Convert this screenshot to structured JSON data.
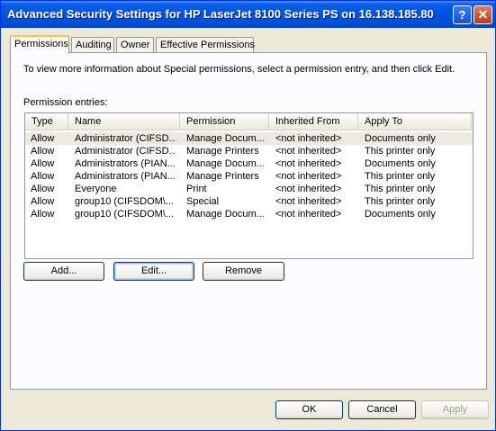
{
  "window": {
    "title": "Advanced Security Settings for HP LaserJet 8100 Series PS on 16.138.185.80",
    "help_glyph": "?",
    "close_glyph": "✕"
  },
  "tabs": [
    {
      "label": "Permissions",
      "active": true
    },
    {
      "label": "Auditing",
      "active": false
    },
    {
      "label": "Owner",
      "active": false
    },
    {
      "label": "Effective Permissions",
      "active": false
    }
  ],
  "permissions_tab": {
    "info_text": "To view more information about Special permissions, select a permission entry, and then click Edit.",
    "entries_label": "Permission entries:",
    "columns": [
      "Type",
      "Name",
      "Permission",
      "Inherited From",
      "Apply To"
    ],
    "rows": [
      {
        "type": "Allow",
        "name": "Administrator (CIFSD...",
        "permission": "Manage Docum...",
        "inherited_from": "<not inherited>",
        "apply_to": "Documents only",
        "selected": true
      },
      {
        "type": "Allow",
        "name": "Administrator (CIFSD...",
        "permission": "Manage Printers",
        "inherited_from": "<not inherited>",
        "apply_to": "This printer only"
      },
      {
        "type": "Allow",
        "name": "Administrators (PIAN...",
        "permission": "Manage Docum...",
        "inherited_from": "<not inherited>",
        "apply_to": "Documents only"
      },
      {
        "type": "Allow",
        "name": "Administrators (PIAN...",
        "permission": "Manage Printers",
        "inherited_from": "<not inherited>",
        "apply_to": "This printer only"
      },
      {
        "type": "Allow",
        "name": "Everyone",
        "permission": "Print",
        "inherited_from": "<not inherited>",
        "apply_to": "This printer only"
      },
      {
        "type": "Allow",
        "name": "group10 (CIFSDOM\\...",
        "permission": "Special",
        "inherited_from": "<not inherited>",
        "apply_to": "This printer only"
      },
      {
        "type": "Allow",
        "name": "group10 (CIFSDOM\\...",
        "permission": "Manage Docum...",
        "inherited_from": "<not inherited>",
        "apply_to": "Documents only"
      }
    ],
    "add_button": "Add...",
    "edit_button": "Edit...",
    "remove_button": "Remove"
  },
  "footer": {
    "ok_button": "OK",
    "cancel_button": "Cancel",
    "apply_button": "Apply"
  },
  "colors": {
    "titlebar": "#0054e3",
    "dialog_bg": "#ece9d8",
    "tab_highlight": "#ffc83c"
  }
}
